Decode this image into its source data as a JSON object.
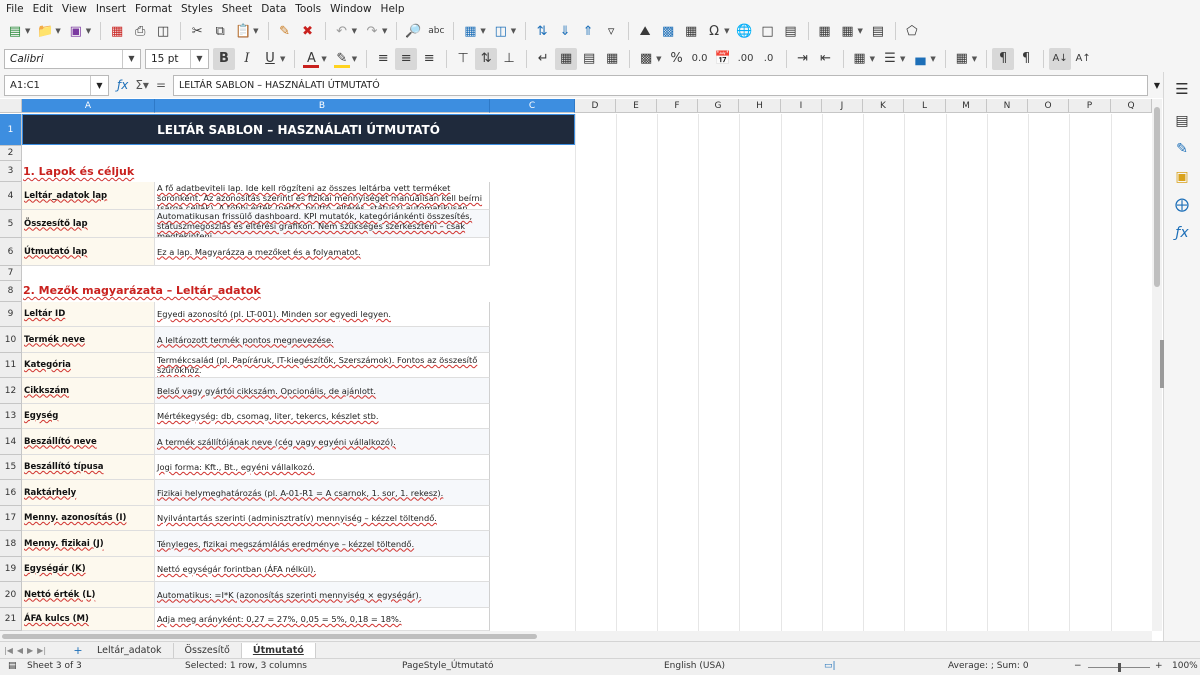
{
  "menu": [
    "File",
    "Edit",
    "View",
    "Insert",
    "Format",
    "Styles",
    "Sheet",
    "Data",
    "Tools",
    "Window",
    "Help"
  ],
  "format": {
    "font_name": "Calibri",
    "font_size": "15 pt"
  },
  "formula": {
    "cell_ref": "A1:C1",
    "content": "LELTÁR SABLON – HASZNÁLATI ÚTMUTATÓ"
  },
  "columns": [
    "A",
    "B",
    "C",
    "D",
    "E",
    "F",
    "G",
    "H",
    "I",
    "J",
    "K",
    "L",
    "M",
    "N",
    "O",
    "P",
    "Q"
  ],
  "rows": [
    "1",
    "2",
    "3",
    "4",
    "5",
    "6",
    "7",
    "8",
    "9",
    "10",
    "11",
    "12",
    "13",
    "14",
    "15",
    "16",
    "17",
    "18",
    "19",
    "20",
    "21"
  ],
  "sheet": {
    "title": "LELTÁR SABLON – HASZNÁLATI ÚTMUTATÓ",
    "section1": "1. Lapok és céljuk",
    "section2": "2. Mezők magyarázata – Leltár_adatok",
    "sheets_table": [
      {
        "name": "Leltár_adatok lap",
        "desc": "A fő adatbeviteli lap. Ide kell rögzíteni az összes leltárba vett terméket soronként. Az azonosítás szerinti és fizikai mennyiséget manuálisan kell beírni (sárga cellák). A többi érték (nettó, bruttó, eltérés, státusz) automatikusan számítódik."
      },
      {
        "name": "Összesítő lap",
        "desc": "Automatikusan frissülő dashboard. KPI mutatók, kategóriánkénti összesítés, státuszmegoszlás és eltérési grafikon. Nem szükséges szerkeszteni – csak megtekinteni."
      },
      {
        "name": "Útmutató lap",
        "desc": "Ez a lap. Magyarázza a mezőket és a folyamatot."
      }
    ],
    "fields": [
      {
        "name": "Leltár ID",
        "desc": "Egyedi azonosító (pl. LT-001). Minden sor egyedi legyen."
      },
      {
        "name": "Termék neve",
        "desc": "A leltározott termék pontos megnevezése."
      },
      {
        "name": "Kategória",
        "desc": "Termékcsalád (pl. Papíráruk, IT-kiegészítők, Szerszámok). Fontos az összesítő szűrőkhöz."
      },
      {
        "name": "Cikkszám",
        "desc": "Belső vagy gyártói cikkszám. Opcionális, de ajánlott."
      },
      {
        "name": "Egység",
        "desc": "Mértékegység: db, csomag, liter, tekercs, készlet stb."
      },
      {
        "name": "Beszállító neve",
        "desc": "A termék szállítójának neve (cég vagy egyéni vállalkozó)."
      },
      {
        "name": "Beszállító típusa",
        "desc": "Jogi forma: Kft., Bt., egyéni vállalkozó."
      },
      {
        "name": "Raktárhely",
        "desc": "Fizikai helymeghatározás (pl. A-01-R1 = A csarnok, 1. sor, 1. rekesz)."
      },
      {
        "name": "Menny. azonosítás (I)",
        "desc": "Nyilvántartás szerinti (adminisztratív) mennyiség – kézzel töltendő."
      },
      {
        "name": "Menny. fizikai (J)",
        "desc": "Tényleges, fizikai megszámlálás eredménye – kézzel töltendő."
      },
      {
        "name": "Egységár (K)",
        "desc": "Nettó egységár forintban (ÁFA nélkül)."
      },
      {
        "name": "Nettó érték (L)",
        "desc": "Automatikus: =I*K (azonosítás szerinti mennyiség × egységár)."
      },
      {
        "name": "ÁFA kulcs (M)",
        "desc": "Adja meg arányként: 0,27 = 27%, 0,05 = 5%, 0,18 = 18%."
      }
    ]
  },
  "tabs": [
    "Leltár_adatok",
    "Összesítő",
    "Útmutató"
  ],
  "status": {
    "sheet": "Sheet 3 of 3",
    "selection": "Selected: 1 row, 3 columns",
    "page_style": "PageStyle_Útmutató",
    "language": "English (USA)",
    "stats": "Average: ; Sum: 0",
    "zoom": "100%"
  },
  "colors": {
    "title_bg": "#1f2a3c",
    "accent": "#c9211e",
    "selection": "#3d8ee0",
    "label_bg": "#fdf9ee"
  },
  "icons": [
    "new-icon",
    "open-icon",
    "save-icon",
    "export-pdf-icon",
    "print-icon",
    "print-preview-icon",
    "cut-icon",
    "copy-icon",
    "paste-icon",
    "clone-format-icon",
    "clear-format-icon",
    "undo-icon",
    "redo-icon",
    "find-replace-icon",
    "spelling-icon",
    "row-icon",
    "column-icon",
    "sort-icon",
    "sort-ascending-icon",
    "sort-descending-icon",
    "autofilter-icon",
    "image-icon",
    "chart-icon",
    "pivot-table-icon",
    "special-character-icon",
    "hyperlink-icon",
    "comment-icon",
    "headers-footers-icon",
    "define-print-area-icon",
    "freeze-rows-columns-icon",
    "split-window-icon",
    "show-draw-functions-icon"
  ]
}
